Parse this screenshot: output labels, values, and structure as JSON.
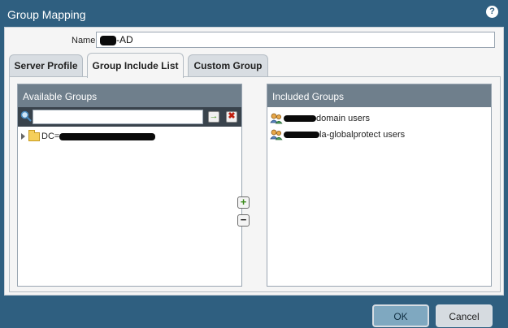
{
  "dialog": {
    "title": "Group Mapping",
    "help_icon": "?"
  },
  "name_field": {
    "label": "Name",
    "value": "-AD"
  },
  "tabs": [
    {
      "label": "Server Profile",
      "active": false
    },
    {
      "label": "Group Include List",
      "active": true
    },
    {
      "label": "Custom Group",
      "active": false
    }
  ],
  "available_groups": {
    "header": "Available Groups",
    "search_value": "",
    "tree_items": [
      {
        "label": "DC="
      }
    ]
  },
  "included_groups": {
    "header": "Included Groups",
    "items": [
      {
        "label": "domain users"
      },
      {
        "label": "la-globalprotect users"
      }
    ]
  },
  "controls": {
    "add_symbol": "+",
    "remove_symbol": "−",
    "go_symbol": "→",
    "clear_symbol": "✖"
  },
  "footer": {
    "ok_label": "OK",
    "cancel_label": "Cancel"
  },
  "colors": {
    "title_bar": "#2f5f80",
    "panel_header": "#6f7f8c",
    "ok_button": "#7fa8c0"
  }
}
